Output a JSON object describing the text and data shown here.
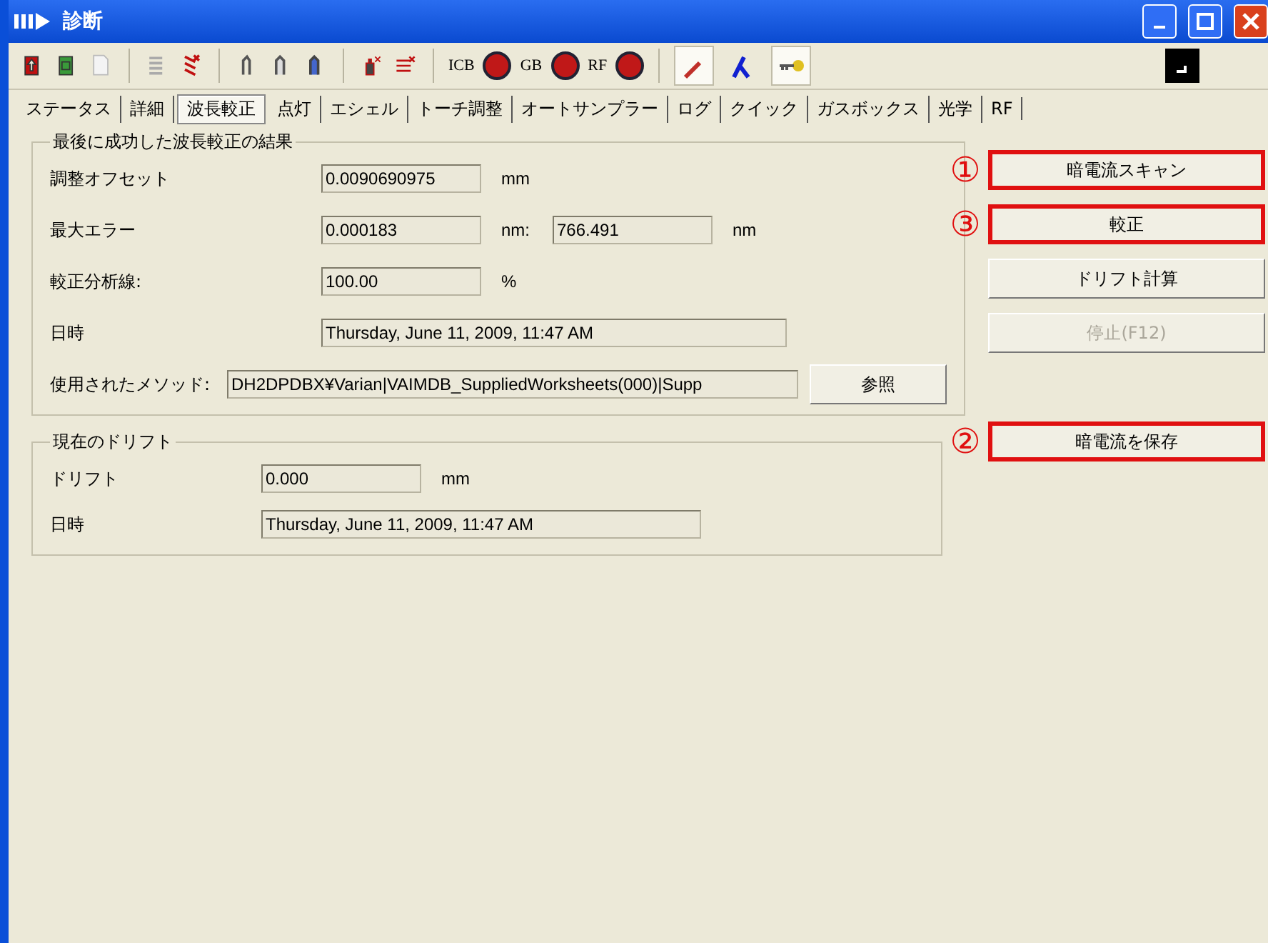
{
  "window": {
    "title": "診断"
  },
  "toolbar": {
    "indicators": [
      {
        "label": "ICB"
      },
      {
        "label": "GB"
      },
      {
        "label": "RF"
      }
    ],
    "toggles": [
      {
        "pressed": true
      },
      {
        "pressed": false
      },
      {
        "pressed": true
      }
    ]
  },
  "tabs": [
    {
      "label": "ステータス",
      "selected": false
    },
    {
      "label": "詳細",
      "selected": false
    },
    {
      "label": "波長較正",
      "selected": true
    },
    {
      "label": "点灯",
      "selected": false
    },
    {
      "label": "エシェル",
      "selected": false
    },
    {
      "label": "トーチ調整",
      "selected": false
    },
    {
      "label": "オートサンプラー",
      "selected": false
    },
    {
      "label": "ログ",
      "selected": false
    },
    {
      "label": "クイック",
      "selected": false
    },
    {
      "label": "ガスボックス",
      "selected": false
    },
    {
      "label": "光学",
      "selected": false
    },
    {
      "label": "RF",
      "selected": false
    }
  ],
  "last_calibration": {
    "title": "最後に成功した波長較正の結果",
    "offset": {
      "label": "調整オフセット",
      "value": "0.0090690975",
      "unit": "mm"
    },
    "max_error": {
      "label": "最大エラー",
      "value": "0.000183",
      "unit": "nm:",
      "value_2": "766.491",
      "unit_2": "nm"
    },
    "analysis_lines": {
      "label": "較正分析線:",
      "value": "100.00",
      "unit": "%"
    },
    "datetime": {
      "label": "日時",
      "value": "Thursday, June 11, 2009, 11:47 AM"
    },
    "method": {
      "label": "使用されたメソッド:",
      "value": "DH2DPDBX¥Varian|VAIMDB_SuppliedWorksheets(000)|Supp",
      "browse": "参照"
    }
  },
  "current_drift": {
    "title": "現在のドリフト",
    "drift": {
      "label": "ドリフト",
      "value": "0.000",
      "unit": "mm"
    },
    "datetime": {
      "label": "日時",
      "value": "Thursday, June 11, 2009, 11:47 AM"
    }
  },
  "actions": [
    {
      "label": "暗電流スキャン",
      "annotation": "①",
      "highlighted": true,
      "disabled": false
    },
    {
      "label": "較正",
      "annotation": "③",
      "highlighted": true,
      "disabled": false
    },
    {
      "label": "ドリフト計算",
      "highlighted": false,
      "disabled": false
    },
    {
      "label": "停止(F12)",
      "highlighted": false,
      "disabled": true
    }
  ],
  "drift_actions": [
    {
      "label": "暗電流を保存",
      "annotation": "②",
      "highlighted": true,
      "disabled": false
    }
  ]
}
